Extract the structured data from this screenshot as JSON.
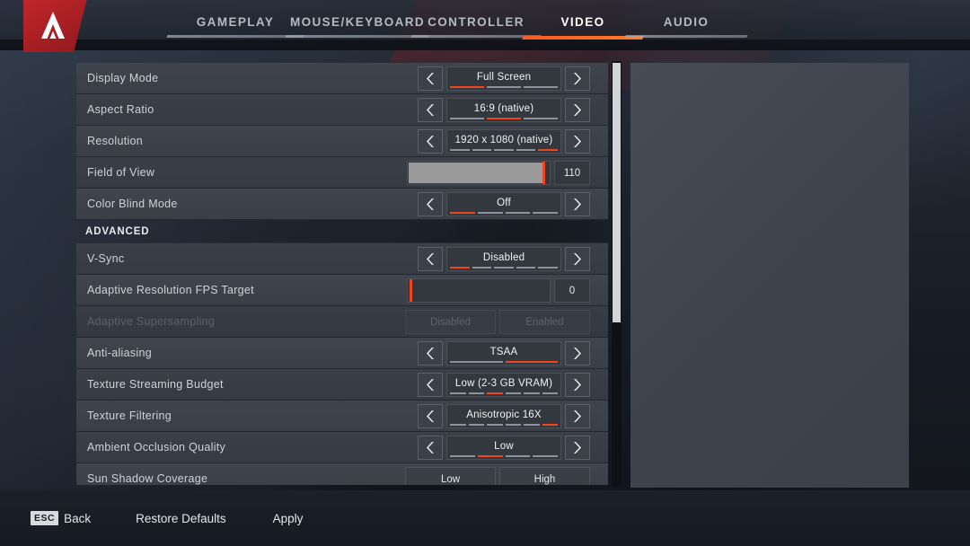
{
  "header": {
    "logo_icon": "apex-legends-logo",
    "tabs": [
      {
        "label": "GAMEPLAY",
        "active": false
      },
      {
        "label": "MOUSE/KEYBOARD",
        "active": false
      },
      {
        "label": "CONTROLLER",
        "active": false
      },
      {
        "label": "VIDEO",
        "active": true
      },
      {
        "label": "AUDIO",
        "active": false
      }
    ]
  },
  "colors": {
    "accent_red": "#f1451b",
    "tab_active_bg": "#a32024",
    "row_bg": "#3f444d",
    "value_bg": "#33373e",
    "scrollbar_thumb": "#d2d4d7"
  },
  "settings": {
    "section_label": "ADVANCED",
    "rows": [
      {
        "label": "Display Mode",
        "type": "stepper",
        "value": "Full Screen",
        "segments": 3,
        "active_segment": 1,
        "disabled": false
      },
      {
        "label": "Aspect Ratio",
        "type": "stepper",
        "value": "16:9 (native)",
        "segments": 3,
        "active_segment": 2,
        "disabled": false
      },
      {
        "label": "Resolution",
        "type": "stepper",
        "value": "1920 x 1080 (native)",
        "segments": 5,
        "active_segment": 5,
        "disabled": false
      },
      {
        "label": "Field of View",
        "type": "slider",
        "value": "110",
        "percent": 97,
        "disabled": false
      },
      {
        "label": "Color Blind Mode",
        "type": "stepper",
        "value": "Off",
        "segments": 4,
        "active_segment": 1,
        "disabled": false
      },
      {
        "label": "V-Sync",
        "type": "stepper",
        "value": "Disabled",
        "segments": 5,
        "active_segment": 1,
        "disabled": false
      },
      {
        "label": "Adaptive Resolution FPS Target",
        "type": "slider",
        "value": "0",
        "percent": 0,
        "disabled": false
      },
      {
        "label": "Adaptive Supersampling",
        "type": "toggle",
        "option_left": "Disabled",
        "option_right": "Enabled",
        "disabled": true
      },
      {
        "label": "Anti-aliasing",
        "type": "stepper",
        "value": "TSAA",
        "segments": 2,
        "active_segment": 2,
        "disabled": false
      },
      {
        "label": "Texture Streaming Budget",
        "type": "stepper",
        "value": "Low (2-3 GB VRAM)",
        "segments": 6,
        "active_segment": 3,
        "disabled": false
      },
      {
        "label": "Texture Filtering",
        "type": "stepper",
        "value": "Anisotropic 16X",
        "segments": 6,
        "active_segment": 6,
        "disabled": false
      },
      {
        "label": "Ambient Occlusion Quality",
        "type": "stepper",
        "value": "Low",
        "segments": 4,
        "active_segment": 2,
        "disabled": false
      },
      {
        "label": "Sun Shadow Coverage",
        "type": "toggle",
        "option_left": "Low",
        "option_right": "High",
        "disabled": false
      }
    ]
  },
  "footer": {
    "back_key": "ESC",
    "back_label": "Back",
    "restore_label": "Restore Defaults",
    "apply_label": "Apply"
  }
}
